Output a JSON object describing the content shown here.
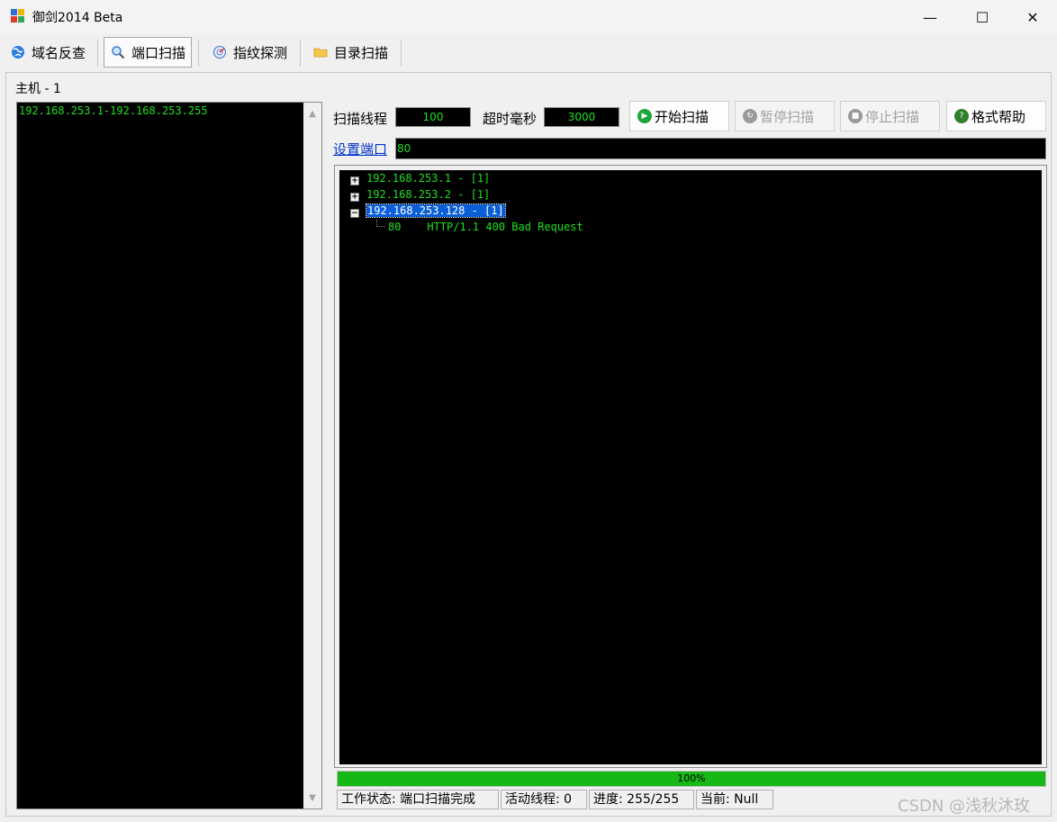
{
  "window": {
    "title": "御剑2014 Beta",
    "minimize": "—",
    "maximize": "☐",
    "close": "✕"
  },
  "toolbar": {
    "tabs": [
      {
        "label": "域名反查",
        "icon": "globe-icon"
      },
      {
        "label": "端口扫描",
        "icon": "magnifier-icon"
      },
      {
        "label": "指纹探测",
        "icon": "radar-icon"
      },
      {
        "label": "目录扫描",
        "icon": "folder-icon"
      }
    ],
    "active_tab": "端口扫描"
  },
  "hosts": {
    "label": "主机 - 1",
    "content": "192.168.253.1-192.168.253.255"
  },
  "controls": {
    "threads_label": "扫描线程",
    "threads_value": "100",
    "timeout_label": "超时毫秒",
    "timeout_value": "3000",
    "start_label": "开始扫描",
    "pause_label": "暂停扫描",
    "stop_label": "停止扫描",
    "help_label": "格式帮助",
    "port_link": "设置端口",
    "port_value": "80"
  },
  "results": [
    {
      "host": "192.168.253.1 - [1]",
      "expanded": false
    },
    {
      "host": "192.168.253.2 - [1]",
      "expanded": false
    },
    {
      "host": "192.168.253.128 - [1]",
      "expanded": true,
      "children": [
        "80    HTTP/1.1 400 Bad Request"
      ]
    }
  ],
  "progress": {
    "percent": 100,
    "text": "100%"
  },
  "status": {
    "state": "工作状态: 端口扫描完成",
    "active_threads": "活动线程: 0",
    "progress": "进度: 255/255",
    "current": "当前: Null"
  },
  "watermark": "CSDN @浅秋沐玫",
  "colors": {
    "terminal_green": "#1ee01e",
    "selection": "#0a5fd8",
    "progress": "#16b816"
  }
}
